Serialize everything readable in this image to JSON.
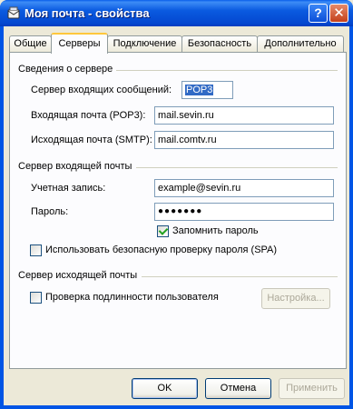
{
  "window": {
    "title": "Моя почта - свойства",
    "help_label": "?",
    "close_label": "✕"
  },
  "tabs": [
    {
      "label": "Общие",
      "active": false
    },
    {
      "label": "Серверы",
      "active": true
    },
    {
      "label": "Подключение",
      "active": false
    },
    {
      "label": "Безопасность",
      "active": false
    },
    {
      "label": "Дополнительно",
      "active": false
    }
  ],
  "server_info": {
    "group_label": "Сведения о сервере",
    "incoming_type_label": "Сервер входящих сообщений:",
    "incoming_type_value": "POP3",
    "incoming_label": "Входящая почта (POP3):",
    "incoming_value": "mail.sevin.ru",
    "outgoing_label": "Исходящая почта (SMTP):",
    "outgoing_value": "mail.comtv.ru"
  },
  "incoming_server": {
    "group_label": "Сервер входящей почты",
    "account_label": "Учетная запись:",
    "account_value": "example@sevin.ru",
    "password_label": "Пароль:",
    "password_value": "●●●●●●●",
    "remember_label": "Запомнить пароль",
    "remember_checked": true,
    "spa_label": "Использовать безопасную проверку пароля (SPA)",
    "spa_checked": false
  },
  "outgoing_server": {
    "group_label": "Сервер исходящей почты",
    "auth_label": "Проверка подлинности пользователя",
    "auth_checked": false,
    "settings_button": "Настройка..."
  },
  "buttons": {
    "ok": "OK",
    "cancel": "Отмена",
    "apply": "Применить"
  }
}
